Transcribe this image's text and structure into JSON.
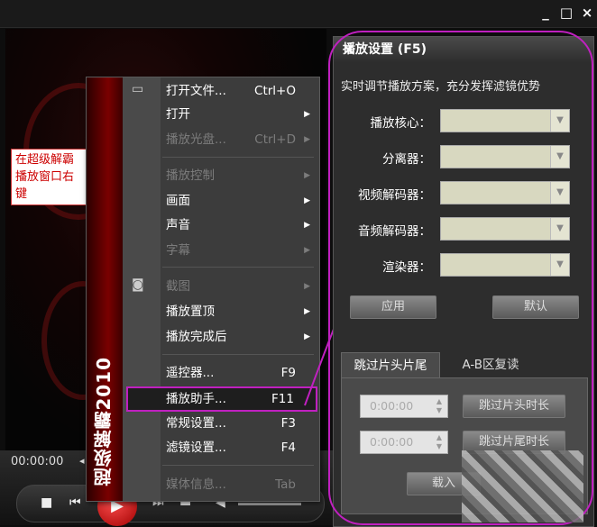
{
  "window": {
    "minimize_label": "_",
    "maximize_label": "□",
    "close_label": "×"
  },
  "annotation": {
    "text": "在超级解霸播放窗口右键"
  },
  "player": {
    "time": "00:00:00",
    "seek_arrow": "◂"
  },
  "menu": {
    "brand_strip": "超级解霸2010",
    "items": [
      {
        "label": "打开文件...",
        "shortcut": "Ctrl+O",
        "arrow": "",
        "disabled": false
      },
      {
        "label": "打开",
        "shortcut": "",
        "arrow": "▶",
        "disabled": false
      },
      {
        "label": "播放光盘...",
        "shortcut": "Ctrl+D",
        "arrow": "▶",
        "disabled": true
      },
      {
        "label": "播放控制",
        "shortcut": "",
        "arrow": "▶",
        "disabled": true
      },
      {
        "label": "画面",
        "shortcut": "",
        "arrow": "▶",
        "disabled": false
      },
      {
        "label": "声音",
        "shortcut": "",
        "arrow": "▶",
        "disabled": false
      },
      {
        "label": "字幕",
        "shortcut": "",
        "arrow": "▶",
        "disabled": true
      },
      {
        "label": "截图",
        "shortcut": "",
        "arrow": "▶",
        "disabled": true
      },
      {
        "label": "播放置顶",
        "shortcut": "",
        "arrow": "▶",
        "disabled": false
      },
      {
        "label": "播放完成后",
        "shortcut": "",
        "arrow": "▶",
        "disabled": false
      },
      {
        "label": "遥控器...",
        "shortcut": "F9",
        "arrow": "",
        "disabled": false
      },
      {
        "label": "播放助手...",
        "shortcut": "F11",
        "arrow": "",
        "disabled": false
      },
      {
        "label": "常规设置...",
        "shortcut": "F3",
        "arrow": "",
        "disabled": false
      },
      {
        "label": "滤镜设置...",
        "shortcut": "F4",
        "arrow": "",
        "disabled": false
      },
      {
        "label": "媒体信息...",
        "shortcut": "Tab",
        "arrow": "",
        "disabled": true
      }
    ]
  },
  "panel": {
    "title": "播放设置 (F5)",
    "close_label": "×",
    "description": "实时调节播放方案，充分发挥滤镜优势",
    "fields": [
      {
        "label": "播放核心：",
        "value": ""
      },
      {
        "label": "分离器：",
        "value": ""
      },
      {
        "label": "视频解码器：",
        "value": ""
      },
      {
        "label": "音频解码器：",
        "value": ""
      },
      {
        "label": "渲染器：",
        "value": ""
      }
    ],
    "apply_label": "应用",
    "default_label": "默认",
    "tabs": [
      {
        "label": "跳过片头片尾"
      },
      {
        "label": "A-B区复读"
      }
    ],
    "skip_head": {
      "time": "0:00:00",
      "button": "跳过片头时长"
    },
    "skip_tail": {
      "time": "0:00:00",
      "button": "跳过片尾时长"
    },
    "bottom_button": "载入"
  }
}
